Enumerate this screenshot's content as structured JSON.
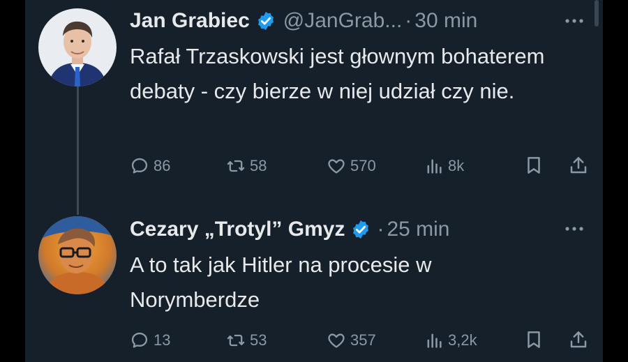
{
  "tweets": [
    {
      "author": "Jan Grabiec",
      "handle": "@JanGrab...",
      "separator": "·",
      "time": "30 min",
      "text": "Rafał Trzaskowski jest głownym bohaterem debaty - czy bierze w niej udział czy nie.",
      "replies": "86",
      "retweets": "58",
      "likes": "570",
      "views": "8k"
    },
    {
      "author": "Cezary „Trotyl” Gmyz",
      "separator": "·",
      "time": "25 min",
      "text": "A to tak jak Hitler na procesie w Norymberdze",
      "replies": "13",
      "retweets": "53",
      "likes": "357",
      "views": "3,2k"
    }
  ],
  "colors": {
    "background": "#15202b",
    "text": "#e7e9ea",
    "muted": "#8b98a5",
    "verified": "#1d9bf0"
  }
}
